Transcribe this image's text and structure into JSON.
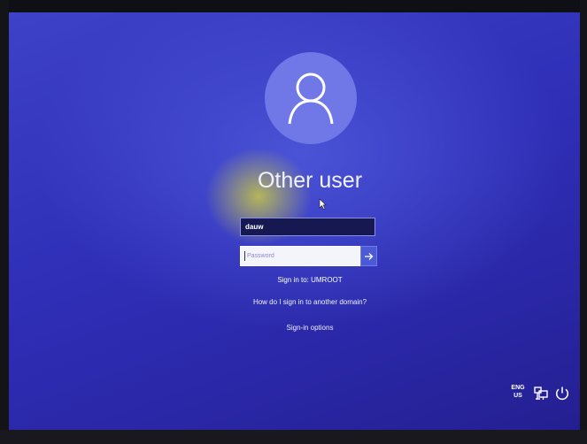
{
  "user": {
    "title": "Other user",
    "username_value": "dauw",
    "password_placeholder": "Password"
  },
  "sign_in_to": "Sign in to: UMROOT",
  "links": {
    "other_domain": "How do I sign in to another domain?",
    "sign_in_options": "Sign-in options"
  },
  "tray": {
    "lang_top": "ENG",
    "lang_bottom": "US"
  },
  "icons": {
    "avatar": "user-silhouette-icon",
    "submit": "arrow-right-icon",
    "network": "network-icon",
    "power": "power-icon"
  },
  "colors": {
    "background": "#3d42c8",
    "avatar": "#6f78e6",
    "submit_button": "#4c5ad8"
  }
}
